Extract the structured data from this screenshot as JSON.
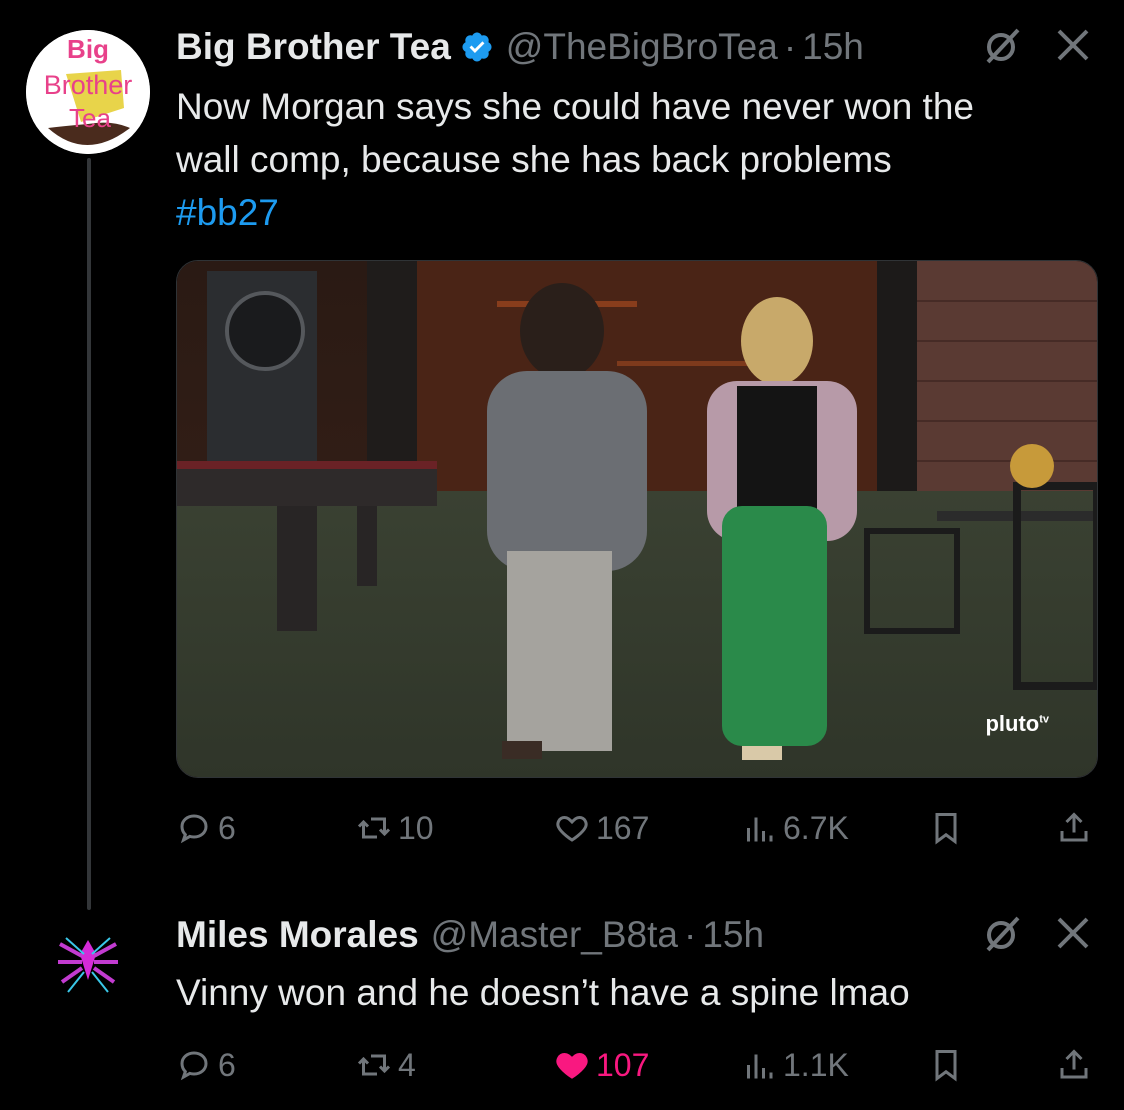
{
  "tweet": {
    "avatar_text": [
      "Big",
      "Brother",
      "Tea"
    ],
    "name": "Big Brother Tea",
    "handle": "@TheBigBroTea",
    "time": "15h",
    "text_lines": [
      "Now Morgan says she could have never won the",
      "wall comp, because she has back problems"
    ],
    "hashtag": "#bb27",
    "media_watermark": "pluto",
    "media_watermark_sup": "tv",
    "stats": {
      "replies": "6",
      "reposts": "10",
      "likes": "167",
      "views": "6.7K"
    }
  },
  "reply": {
    "name": "Miles Morales",
    "handle": "@Master_B8ta",
    "time": "15h",
    "text": "Vinny won and he doesn’t have a spine lmao",
    "stats": {
      "replies": "6",
      "reposts": "4",
      "likes": "107",
      "views": "1.1K"
    },
    "liked": true
  },
  "colors": {
    "accent": "#1d9bf0",
    "like": "#f91880",
    "muted": "#71767b",
    "text": "#e7e9ea"
  },
  "icons": [
    "verified-icon",
    "grok-icon",
    "close-icon",
    "reply-icon",
    "repost-icon",
    "like-icon",
    "views-icon",
    "bookmark-icon",
    "share-icon"
  ]
}
